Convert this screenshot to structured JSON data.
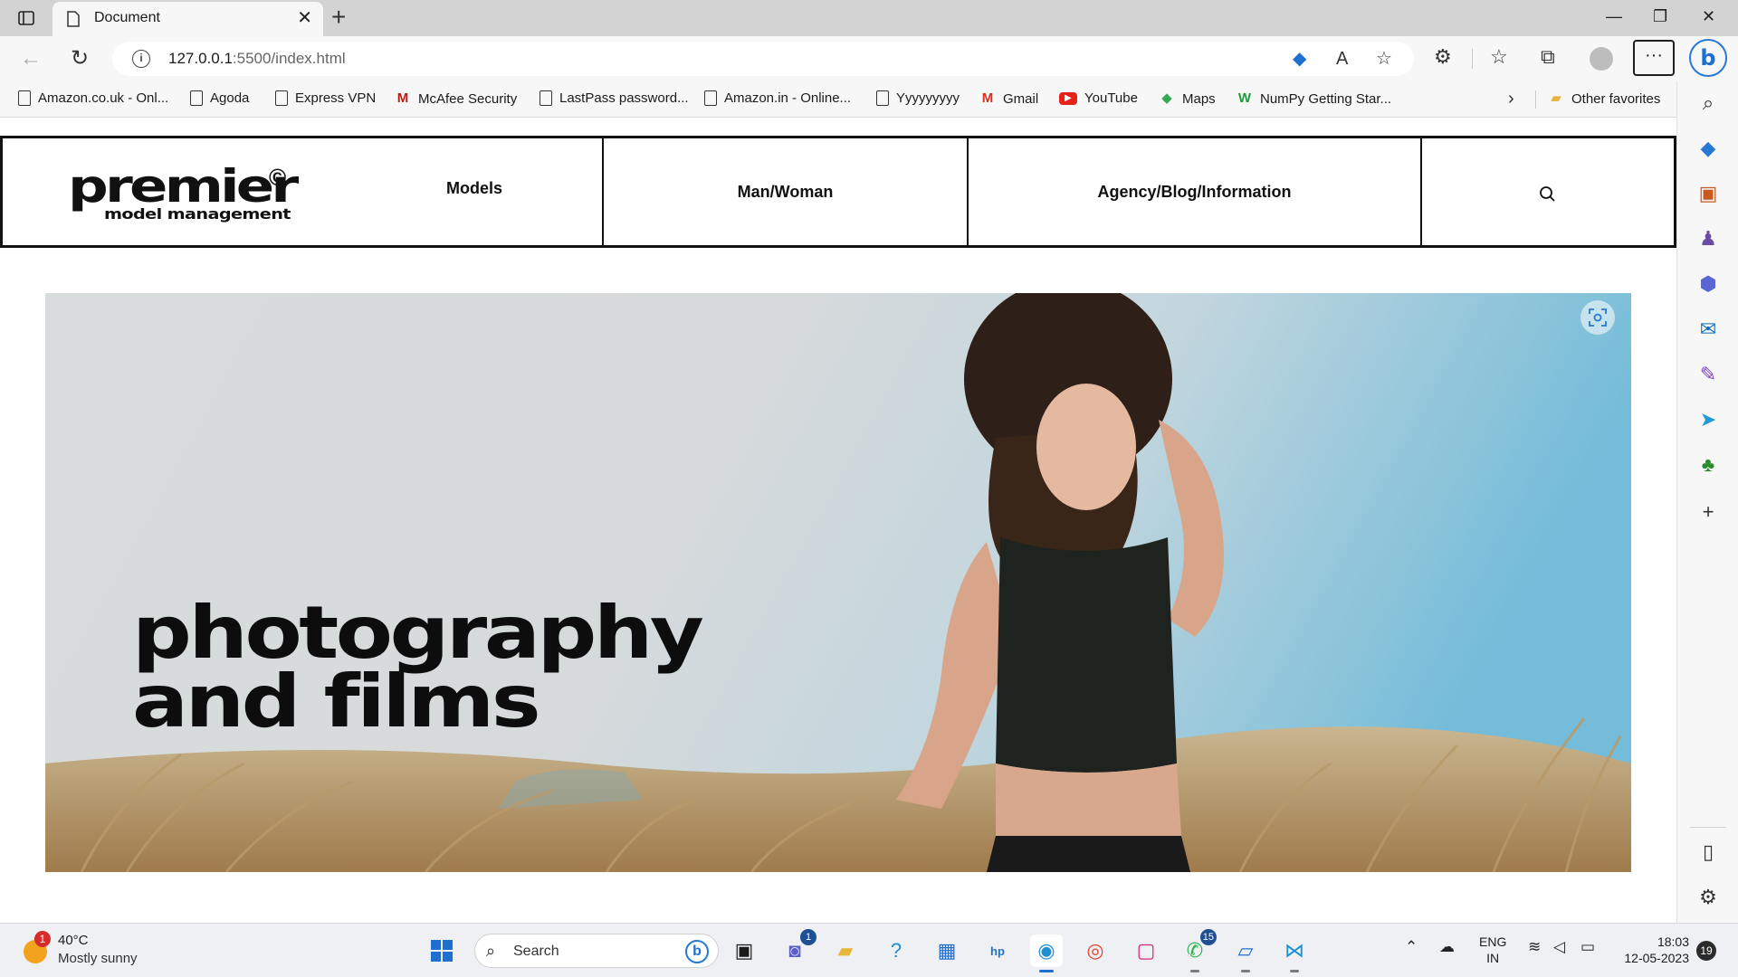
{
  "browser": {
    "tab_title": "Document",
    "url_host": "127.0.0.1",
    "url_rest": ":5500/index.html",
    "bookmarks": [
      {
        "label": "Amazon.co.uk - Onl...",
        "icon": "page-icon"
      },
      {
        "label": "Agoda",
        "icon": "page-icon"
      },
      {
        "label": "Express VPN",
        "icon": "page-icon"
      },
      {
        "label": "McAfee Security",
        "icon": "mcafee-icon"
      },
      {
        "label": "LastPass password...",
        "icon": "page-icon"
      },
      {
        "label": "Amazon.in - Online...",
        "icon": "page-icon"
      },
      {
        "label": "Yyyyyyyyy",
        "icon": "page-icon"
      },
      {
        "label": "Gmail",
        "icon": "gmail-icon"
      },
      {
        "label": "YouTube",
        "icon": "youtube-icon"
      },
      {
        "label": "Maps",
        "icon": "maps-icon"
      },
      {
        "label": "NumPy Getting Star...",
        "icon": "numpy-icon"
      }
    ],
    "other_favorites": "Other favorites"
  },
  "site": {
    "logo_main": "premier",
    "logo_copy": "©",
    "logo_sub": "model management",
    "nav": {
      "models": "Models",
      "man_woman": "Man/Woman",
      "agency": "Agency/Blog/Information"
    },
    "hero_line1": "photography",
    "hero_line2": "and films"
  },
  "taskbar": {
    "weather_badge": "1",
    "temperature": "40°C",
    "condition": "Mostly sunny",
    "search_label": "Search",
    "teams_badge": "1",
    "whatsapp_badge": "15",
    "lang_1": "ENG",
    "lang_2": "IN",
    "time": "18:03",
    "date": "12-05-2023",
    "notifications": "19"
  },
  "colors": {
    "accent": "#1f6fd1",
    "chrome": "#f7f7f7",
    "tabbar": "#d3d3d3",
    "taskbar": "#eef0f4"
  }
}
